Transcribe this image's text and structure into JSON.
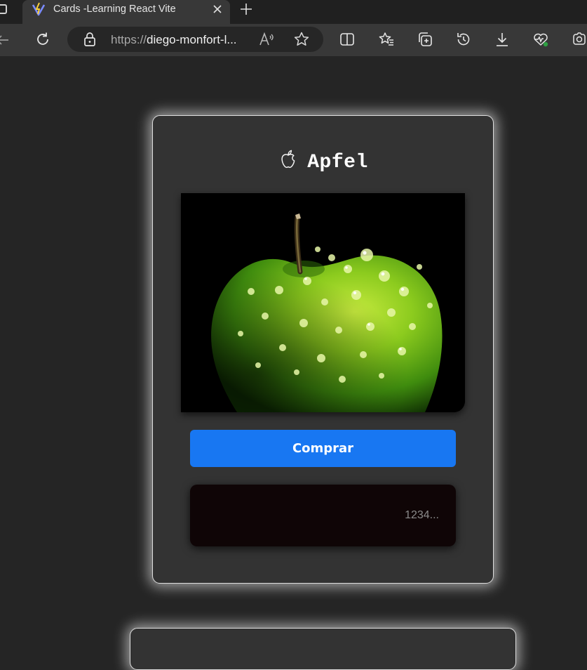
{
  "browser": {
    "tab": {
      "title": "Cards -Learning React Vite",
      "active": true
    },
    "address_bar": {
      "scheme": "https://",
      "host": "diego-monfort-l..."
    },
    "icons": [
      "window-icon",
      "vite-favicon",
      "close-icon",
      "new-tab-icon",
      "back-icon",
      "refresh-icon",
      "lock-icon",
      "read-aloud-icon",
      "favorite-star-icon",
      "split-screen-icon",
      "favorites-icon",
      "collections-icon",
      "history-icon",
      "downloads-icon",
      "browser-essentials-icon",
      "screenshot-icon"
    ]
  },
  "card": {
    "logo_icon": "apple-logo-icon",
    "title": "Apfel",
    "image": "green-apple-with-water-drops",
    "buy_label": "Comprar",
    "code_input": {
      "value": "",
      "placeholder": "1234..."
    }
  },
  "colors": {
    "page_bg": "#252525",
    "card_bg": "#333333",
    "button_bg": "#1877f2",
    "input_bg": "#0f0506"
  }
}
